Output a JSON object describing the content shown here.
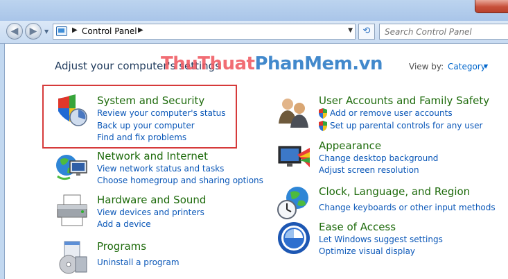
{
  "address": {
    "path_label": "Control Panel",
    "search_placeholder": "Search Control Panel"
  },
  "main": {
    "heading": "Adjust your computer's settings",
    "view_by_label": "View by:",
    "view_by_value": "Category"
  },
  "watermark": {
    "part1": "ThuThuat",
    "part2": "PhanMem",
    "part3": ".vn"
  },
  "categories": [
    {
      "title": "System and Security",
      "icon": "shield-icon",
      "links": [
        "Review your computer's status",
        "Back up your computer",
        "Find and fix problems"
      ]
    },
    {
      "title": "Network and Internet",
      "icon": "network-globe-icon",
      "links": [
        "View network status and tasks",
        "Choose homegroup and sharing options"
      ]
    },
    {
      "title": "Hardware and Sound",
      "icon": "printer-icon",
      "links": [
        "View devices and printers",
        "Add a device"
      ]
    },
    {
      "title": "Programs",
      "icon": "programs-icon",
      "links": [
        "Uninstall a program"
      ]
    },
    {
      "title": "User Accounts and Family Safety",
      "icon": "users-icon",
      "links": [
        "Add or remove user accounts",
        "Set up parental controls for any user"
      ]
    },
    {
      "title": "Appearance",
      "icon": "appearance-icon",
      "links": [
        "Change desktop background",
        "Adjust screen resolution"
      ]
    },
    {
      "title": "Clock, Language, and Region",
      "icon": "clock-globe-icon",
      "links": [
        "Change keyboards or other input methods"
      ]
    },
    {
      "title": "Ease of Access",
      "icon": "ease-of-access-icon",
      "links": [
        "Let Windows suggest settings",
        "Optimize visual display"
      ]
    }
  ],
  "colors": {
    "category_title": "#1e6b0c",
    "link": "#0a57b8",
    "heading": "#1e395b",
    "highlight_border": "#d63a3a"
  }
}
